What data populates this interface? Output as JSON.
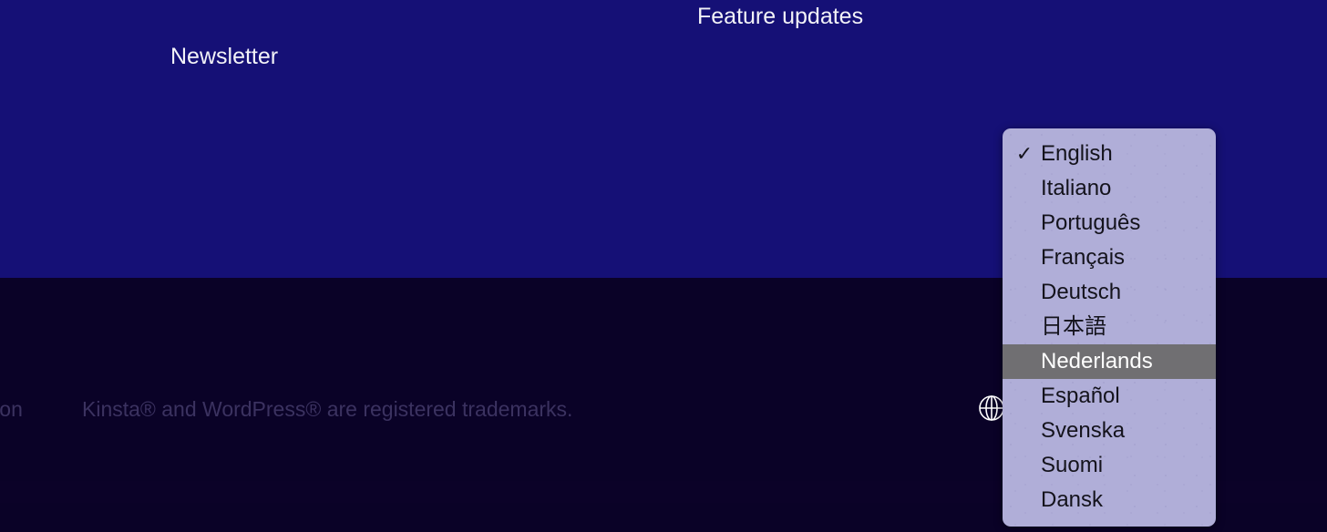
{
  "colors": {
    "band_top": "#151076",
    "band_bottom": "#0a0227",
    "nav_text": "#f2f2f7",
    "footer_text": "#3b3260",
    "dropdown_bg": "#b0aed8",
    "dropdown_text": "#14131c",
    "dropdown_highlight_bg": "#706f72",
    "dropdown_highlight_text": "#ffffff"
  },
  "nav": {
    "feature_updates": "Feature updates",
    "newsletter": "Newsletter"
  },
  "footer": {
    "documentation_partial": "ation",
    "trademark_notice": "Kinsta® and WordPress® are registered trademarks.",
    "language_icon": "globe-icon"
  },
  "language_dropdown": {
    "selected": "English",
    "highlighted": "Nederlands",
    "check_glyph": "✓",
    "items": [
      {
        "label": "English",
        "checked": true,
        "highlighted": false
      },
      {
        "label": "Italiano",
        "checked": false,
        "highlighted": false
      },
      {
        "label": "Português",
        "checked": false,
        "highlighted": false
      },
      {
        "label": "Français",
        "checked": false,
        "highlighted": false
      },
      {
        "label": "Deutsch",
        "checked": false,
        "highlighted": false
      },
      {
        "label": "日本語",
        "checked": false,
        "highlighted": false
      },
      {
        "label": "Nederlands",
        "checked": false,
        "highlighted": true
      },
      {
        "label": "Español",
        "checked": false,
        "highlighted": false
      },
      {
        "label": "Svenska",
        "checked": false,
        "highlighted": false
      },
      {
        "label": "Suomi",
        "checked": false,
        "highlighted": false
      },
      {
        "label": "Dansk",
        "checked": false,
        "highlighted": false
      }
    ]
  }
}
